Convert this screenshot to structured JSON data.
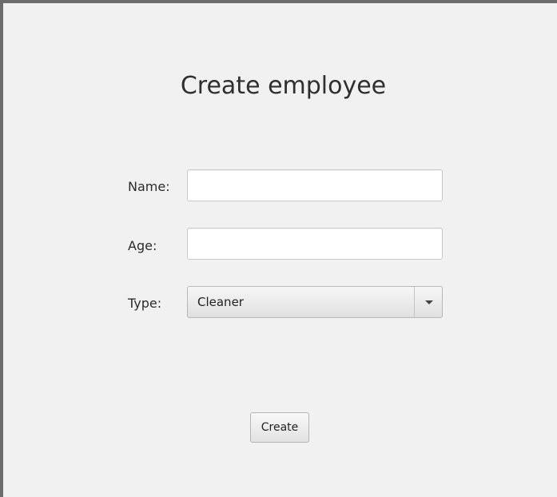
{
  "form": {
    "title": "Create employee",
    "name_label": "Name:",
    "name_value": "",
    "age_label": "Age:",
    "age_value": "",
    "type_label": "Type:",
    "type_selected": "Cleaner",
    "dropdown_icon": "chevron-down-icon",
    "create_label": "Create"
  }
}
